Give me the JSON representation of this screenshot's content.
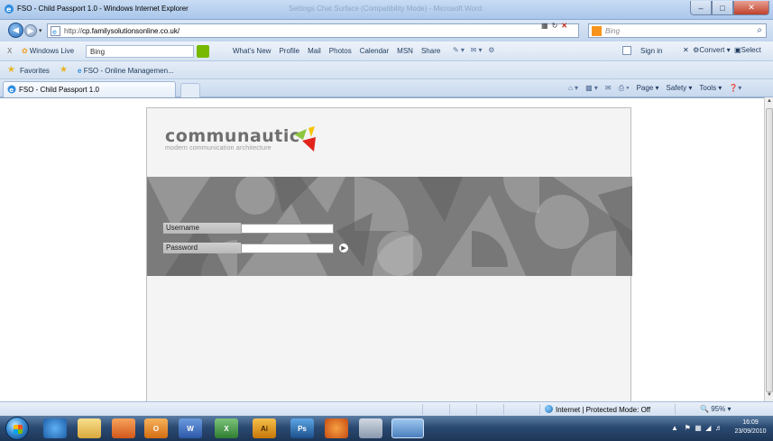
{
  "window": {
    "title": "FSO - Child Passport 1.0 - Windows Internet Explorer",
    "background_title": "Settings Chat Surface (Compatibility Mode) - Microsoft Word",
    "buttons": {
      "minimize": "–",
      "maximize": "□",
      "close": "✕"
    }
  },
  "address_bar": {
    "url": "http://cp.familysolutionsonline.co.uk/",
    "url_host": "cp.familysolutionsonline.co.uk/",
    "url_prefix": "http://",
    "search_placeholder": "Bing"
  },
  "live_toolbar": {
    "close_label": "X",
    "brand": "Windows Live",
    "search_value": "Bing",
    "menu": [
      "What's New",
      "Profile",
      "Mail",
      "Photos",
      "Calendar",
      "MSN",
      "Share"
    ],
    "sign_in": "Sign in",
    "convert_label": "Convert",
    "select_label": "Select"
  },
  "favorites_bar": {
    "label": "Favorites",
    "items": [
      "FSO - Online Managemen..."
    ]
  },
  "tabs": [
    {
      "title": "FSO - Child Passport 1.0",
      "active": true
    }
  ],
  "command_bar": [
    "Page ▾",
    "Safety ▾",
    "Tools ▾"
  ],
  "page": {
    "logo_text": "communautic",
    "tagline": "modern communication architecture",
    "username_label": "Username",
    "password_label": "Password",
    "username_value": "",
    "password_value": "",
    "go_icon": "arrow-right-circle-icon",
    "banner_color": "#7e7e7e",
    "accent_colors": {
      "green": "#8dc63f",
      "yellow": "#f5c400",
      "red": "#e2231a"
    }
  },
  "status_bar": {
    "zone": "Internet | Protected Mode: Off",
    "zoom": "95%"
  },
  "taskbar": {
    "items": [
      {
        "name": "ie",
        "label": ""
      },
      {
        "name": "explorer",
        "label": ""
      },
      {
        "name": "media-player",
        "label": ""
      },
      {
        "name": "outlook",
        "label": "O"
      },
      {
        "name": "word",
        "label": "W"
      },
      {
        "name": "excel",
        "label": "X"
      },
      {
        "name": "illustrator",
        "label": "Ai"
      },
      {
        "name": "photoshop",
        "label": "Ps"
      },
      {
        "name": "firefox",
        "label": ""
      },
      {
        "name": "app",
        "label": ""
      },
      {
        "name": "app-active",
        "label": ""
      }
    ],
    "time": "16:09",
    "date": "23/09/2010"
  }
}
